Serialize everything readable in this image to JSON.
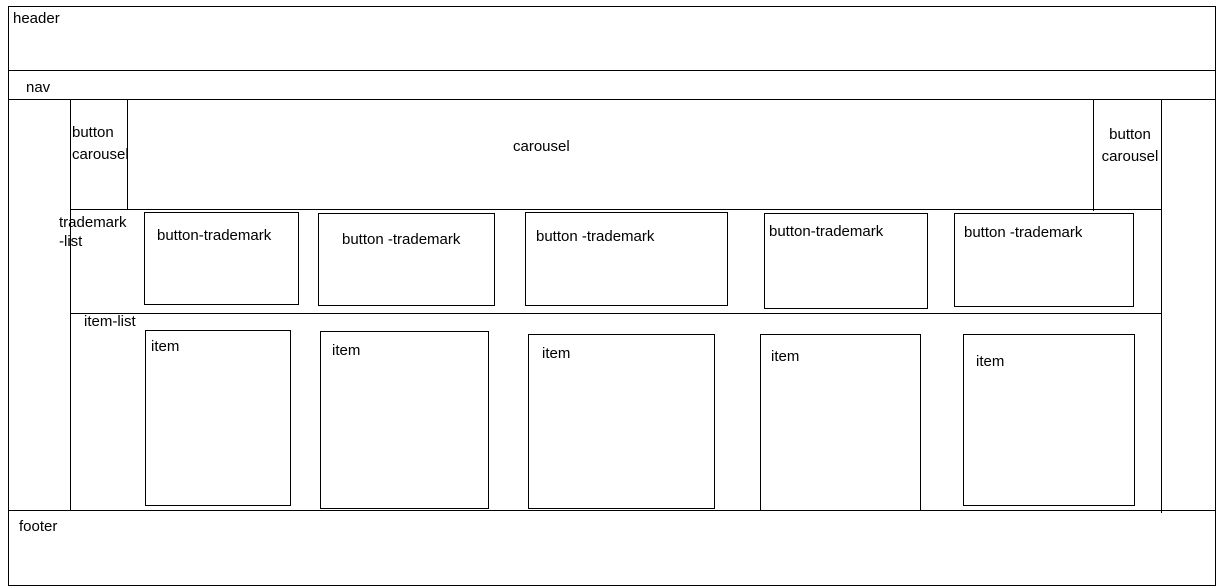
{
  "labels": {
    "header": "header",
    "nav": "nav",
    "button_carousel_left_line1": "button",
    "button_carousel_left_line2": "carousel",
    "carousel": "carousel",
    "button_carousel_right_line1": "button",
    "button_carousel_right_line2": "carousel",
    "trademark_list_line1": "trademark",
    "trademark_list_line2": "-list",
    "item_list": "item-list",
    "footer": "footer"
  },
  "trademark_buttons": [
    {
      "label": "button-trademark"
    },
    {
      "label": "button -trademark"
    },
    {
      "label": "button -trademark"
    },
    {
      "label": "button-trademark"
    },
    {
      "label": "button -trademark"
    }
  ],
  "items": [
    {
      "label": "item"
    },
    {
      "label": "item"
    },
    {
      "label": "item"
    },
    {
      "label": "item"
    },
    {
      "label": "item"
    }
  ]
}
